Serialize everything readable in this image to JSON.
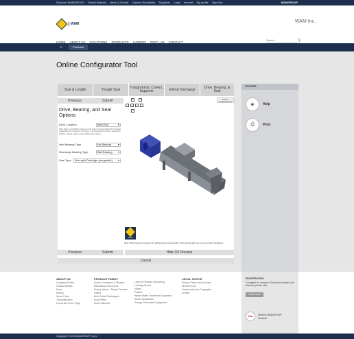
{
  "topbar": {
    "links": [
      "Discover WAMGROUP",
      "Global Network",
      "News & Events",
      "Careers Worldwide",
      "Suppliers",
      "Login",
      "Intranet",
      "My profile",
      "Sign Out"
    ],
    "brand": "WAMGROUP"
  },
  "header": {
    "logo_text": "WAM",
    "site_name": "WAM Inc.",
    "nav": [
      "HOME",
      "ABOUT US",
      "SOLUTIONS",
      "PRODUCTS",
      "CAREER",
      "TEST LAB",
      "CONTACT"
    ],
    "search_placeholder": "Search"
  },
  "breadcrumb": {
    "current": "Products"
  },
  "page_title": "Online Configurator Tool",
  "steps": [
    {
      "label": "Size & Length",
      "active": false
    },
    {
      "label": "Trough Type",
      "active": false
    },
    {
      "label": "Trough Ends, Covers, Supports",
      "active": false
    },
    {
      "label": "Inlet & Discharge",
      "active": false
    },
    {
      "label": "Drive, Bearing, & Seal",
      "active": true
    }
  ],
  "nav_buttons": {
    "previous": "Previous",
    "submit": "Submit",
    "hide_preview": "Hide 3D Preview",
    "cancel": "Cancel"
  },
  "form": {
    "title": "Drive, Bearing, and Seal Options",
    "drive_location_label": "Drive Location",
    "drive_location_value": "Inlet End",
    "note": "Note: Drive is provided for reference only and is a representation of the largest typical drive for a conveyor of this size. If a high-accuracy model is required for detailed analysis, please contact WAM sales support.",
    "inlet_bearing_label": "Inlet Bearing Type",
    "inlet_bearing_value": "No Bearing",
    "discharge_bearing_label": "Discharge Bearing Type",
    "discharge_bearing_value": "Ball Bearing",
    "seal_type_label": "Seal Type",
    "seal_type_value": "Non-split Cartridge (purgeable)"
  },
  "viewer": {
    "drawer_label": "Drawer Requirements",
    "logo_text": "WAM",
    "note": "Note: 3D previews provided is an abbreviated representation. Size and length may not be properly displayed."
  },
  "utilities": {
    "heading": "UTILITIES",
    "help": "Help",
    "print": "Print"
  },
  "footer": {
    "about": {
      "heading": "ABOUT US",
      "items": [
        "Company Profile",
        "Contact Details",
        "News",
        "Events",
        "Spare Parts",
        "Job Application",
        "Corporate Home Page"
      ]
    },
    "products": {
      "heading": "PRODUCT FAMILY",
      "col1": [
        "Screw Conveyors & Feeders",
        "Mechanical Conveyors",
        "Rotary Valves - Rotary Feeders",
        "Valves",
        "Bulk Solids Dischargers",
        "Dust Filters",
        "Dust Collectors"
      ],
      "col2": [
        "Level & Pressure Monitoring",
        "Loading Spouts",
        "Mixers",
        "Flakers",
        "Waste Water Treatment Equipment",
        "Screw Separators",
        "Energy Generation Equipment"
      ]
    },
    "legal": {
      "heading": "LEGAL NOTICE",
      "items": [
        "Privacy Policy and Cookies",
        "Terms of Use",
        "Trademarks and Copyrights",
        "Credits"
      ]
    },
    "registration": {
      "heading": "REGISTRATION",
      "text": "To register for access to Technical Literature and Manuals, please click",
      "button": "SUBSCRIBE"
    },
    "youtube": {
      "icon_text": "You",
      "line1": "Visit the WAMGROUP",
      "line2": "Channel"
    }
  },
  "copyright": "Copyright © 2013 WAMGROUP S.p.A."
}
